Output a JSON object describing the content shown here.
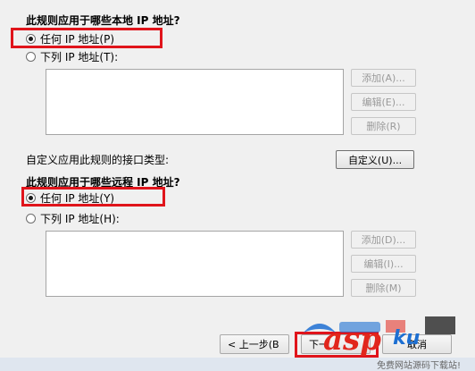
{
  "local": {
    "heading": "此规则应用于哪些本地 IP 地址?",
    "any_label": "任何 IP 地址(P)",
    "these_label": "下列 IP 地址(T):",
    "add": "添加(A)...",
    "edit": "编辑(E)...",
    "remove": "删除(R)"
  },
  "interface": {
    "label": "自定义应用此规则的接口类型:",
    "customize": "自定义(U)..."
  },
  "remote": {
    "heading": "此规则应用于哪些远程 IP 地址?",
    "any_label": "任何 IP 地址(Y)",
    "these_label": "下列 IP 地址(H):",
    "add": "添加(D)...",
    "edit": "编辑(I)...",
    "remove": "删除(M)"
  },
  "footer": {
    "back": "< 上一步(B",
    "next": "下一",
    "cancel": "取消"
  },
  "watermark": {
    "brand": "asp",
    "suffix": "ku",
    "tagline": "免费网站源码下载站!"
  },
  "colors": {
    "highlight": "#e0141b",
    "watermark_red": "#e1261c",
    "watermark_blue": "#1d6fd2"
  }
}
